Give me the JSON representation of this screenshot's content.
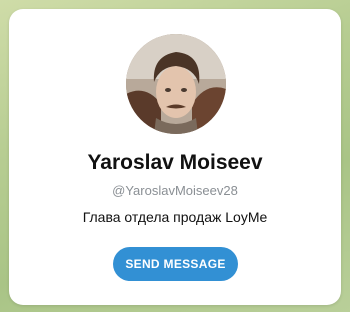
{
  "profile": {
    "display_name": "Yaroslav Moiseev",
    "username": "@YaroslavMoiseev28",
    "bio": "Глава отдела продаж LoyMe",
    "avatar_icon": "user-photo-avatar"
  },
  "actions": {
    "send_message_label": "SEND MESSAGE"
  },
  "colors": {
    "accent": "#3290d4",
    "card_bg": "#ffffff",
    "page_bg": "#b7cd92",
    "muted_text": "#8a8f94"
  }
}
